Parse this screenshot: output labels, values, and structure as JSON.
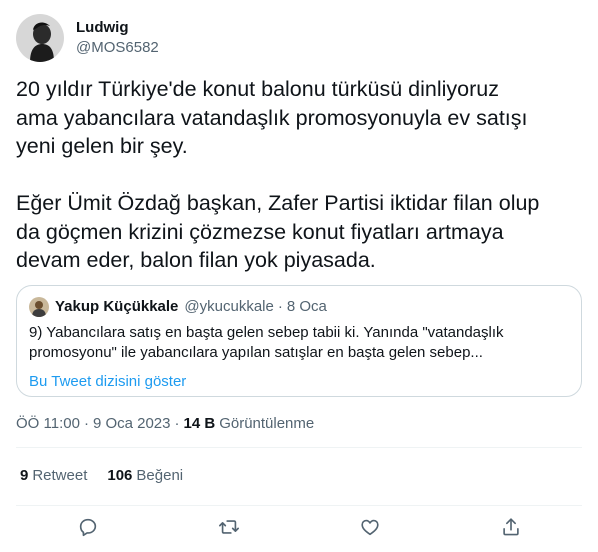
{
  "author": {
    "display_name": "Ludwig",
    "handle": "@MOS6582"
  },
  "tweet": {
    "text": "20 yıldır Türkiye'de konut balonu türküsü dinliyoruz\nama yabancılara vatandaşlık promosyonuyla ev satışı\nyeni gelen bir şey.\n\nEğer Ümit Özdağ başkan, Zafer Partisi iktidar filan olup\nda göçmen krizini çözmezse konut fiyatları artmaya\ndevam eder, balon filan yok piyasada."
  },
  "quote": {
    "display_name": "Yakup Küçükkale",
    "handle": "@ykucukkale",
    "dot": "·",
    "date": "8 Oca",
    "text": "9) Yabancılara satış en başta gelen sebep tabii ki. Yanında \"vatandaşlık\npromosyonu\" ile yabancılara yapılan satışlar en başta gelen sebep...",
    "thread_link": "Bu Tweet dizisini göster"
  },
  "meta": {
    "time": "ÖÖ 11:00",
    "dot1": "·",
    "date": "9 Oca 2023",
    "dot2": "·",
    "views_count": "14 B",
    "views_label": "Görüntülenme"
  },
  "stats": {
    "retweets_count": "9",
    "retweets_label": "Retweet",
    "likes_count": "106",
    "likes_label": "Beğeni"
  },
  "actions": [
    "reply-icon",
    "retweet-icon",
    "like-icon",
    "share-icon"
  ],
  "colors": {
    "text": "#0f1419",
    "secondary": "#536471",
    "link": "#1d9bf0",
    "border": "#cfd9de",
    "divider": "#eff3f4"
  }
}
